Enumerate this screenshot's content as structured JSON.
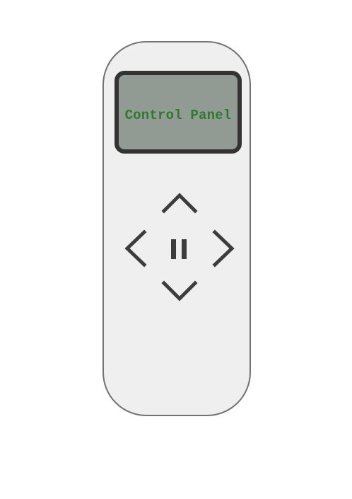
{
  "display": {
    "text": "Control Panel",
    "text_color": "#2d7a2d",
    "screen_color": "#929a94",
    "bezel_color": "#333333"
  },
  "remote": {
    "body_color": "#efefef",
    "outline_color": "#727272"
  },
  "controls": {
    "up": {
      "icon": "chevron-up-icon"
    },
    "down": {
      "icon": "chevron-down-icon"
    },
    "left": {
      "icon": "chevron-left-icon"
    },
    "right": {
      "icon": "chevron-right-icon"
    },
    "center": {
      "icon": "pause-icon"
    },
    "icon_color": "#3c3c3c"
  }
}
